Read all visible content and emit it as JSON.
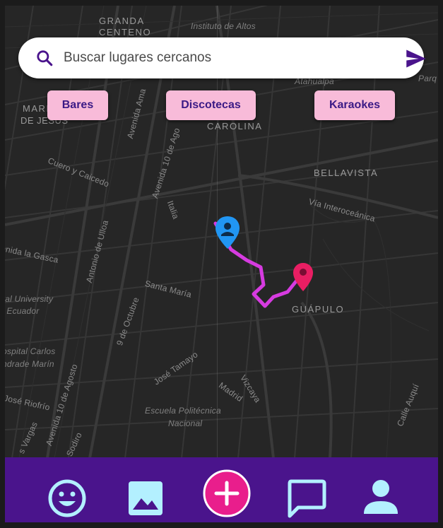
{
  "search": {
    "placeholder": "Buscar lugares cercanos",
    "icon": "search-icon",
    "send_icon": "send-icon"
  },
  "chips": [
    {
      "label": "Bares"
    },
    {
      "label": "Discotecas"
    },
    {
      "label": "Karaokes"
    }
  ],
  "map": {
    "labels": {
      "granda_centeno": "GRANDA\nCENTENO",
      "instituto": "Instituto de Altos",
      "atahualpa": "Atahualpa",
      "parq": "Parq",
      "mariscal": "MARI",
      "de_jesus": "DE JESÚS",
      "carolina": "CAROLINA",
      "bellavista": "BELLAVISTA",
      "via_interoceanica": "Vía Interoceánica",
      "cuero_y_caicedo": "Cuero y Caicedo",
      "avenida_amazonas": "Avenida Ama",
      "avenida_10_agosto_top": "Avenida 10 de Ago",
      "italia": "Italia",
      "la_gasca": "enida la Gasca",
      "antonio_ulloa": "Antonio de Ulloa",
      "santa_maria": "Santa María",
      "central_university": "ral University",
      "del_ecuador": "l Ecuador",
      "nueve_octubre": "9 de Octubre",
      "guapulo": "GUÁPULO",
      "hospital_carlos": "ospital Carlos",
      "andrade_marin": "ndrade Marín",
      "jose_tamayo": "José Tamayo",
      "jose_riofrio": "José Riofrío",
      "avenida_10_agosto_bottom": "Avenida 10 de Agosto",
      "madrid": "Madrid",
      "vizcaya": "Vizcaya",
      "escuela_politecnica": "Escuela Politécnica",
      "nacional": "Nacional",
      "calle_auqui": "Calle Auquí",
      "vargas": "s Vargas",
      "sodiro": "Sodiro"
    },
    "colors": {
      "route": "#d63be0",
      "user_marker": "#2196f3",
      "destination_marker": "#e91e63"
    }
  },
  "nav": {
    "items": [
      {
        "icon": "smiley-icon"
      },
      {
        "icon": "image-icon"
      },
      {
        "icon": "add-icon"
      },
      {
        "icon": "chat-icon"
      },
      {
        "icon": "person-icon"
      }
    ],
    "colors": {
      "background": "#4a148c",
      "icon": "#b3f0ff",
      "add": "#e91e8c"
    }
  }
}
